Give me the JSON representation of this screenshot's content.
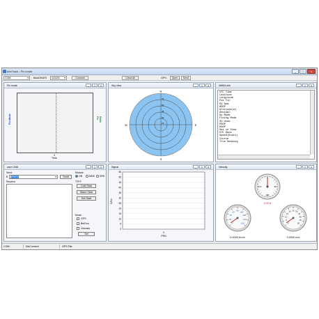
{
  "app": {
    "title": "mtxTrack - Fix mode",
    "controls": {
      "minimize": "_",
      "maximize": "□",
      "close": "x"
    }
  },
  "toolbar": {
    "port": "COM",
    "baudrate_label": "BAUDRATE",
    "baudrate_value": "115200",
    "connect_label": "Connect",
    "clear_all_label": "Clear All",
    "gps_label": "GPS:",
    "open_label": "Open",
    "send_label": "Send"
  },
  "fix_mode": {
    "title": "Fix mode",
    "left_axis": "Fix Mode",
    "right_axis": "Ratio Fix",
    "bottom_tick": "0",
    "bottom_axis": "Time"
  },
  "sky_view": {
    "title": "Sky view",
    "north": "N",
    "south": "S",
    "east": "E",
    "west": "W",
    "rings": [
      "75",
      "60",
      "45",
      "30",
      "15"
    ]
  },
  "nmea_info": {
    "title": "NMEA info",
    "lines": [
      "UTC Time",
      "Latitude",
      "Longitude",
      "Pos Fix",
      "SV Num",
      "HDOP",
      "Altitude(m)",
      "Geoidal",
      "Op Mode",
      "Fixing Mode",
      "SV Used",
      "PDOP",
      "VDOP",
      "Sat in View",
      "UTC Date",
      "Speed(Knots)",
      "Course",
      "True Heading"
    ]
  },
  "user_cmd": {
    "title": "user CMD",
    "send_group": "Send",
    "prefix": "$",
    "cmd_value": "$PMTK",
    "send_button": "Send",
    "receive_label": "Receive",
    "module_label": "Module",
    "module_options": [
      "GB",
      "MDE",
      "SRE"
    ],
    "ttff_label": "TTFF",
    "cold_start": "Cold Start",
    "warm_start": "Warm Start",
    "hot_start": "Hot Start",
    "mode_label": "Mode",
    "mode_options": [
      "GPS",
      "BeiDou",
      "Glonass"
    ],
    "set_button": "Set"
  },
  "signal": {
    "title": "Signal",
    "ylabel": "C/No",
    "xlabel": "PRN",
    "x_tick": "0",
    "y_ticks": [
      "55",
      "50",
      "45",
      "40",
      "35",
      "30",
      "25",
      "20",
      "15",
      "10",
      "5",
      "0"
    ]
  },
  "velocity": {
    "title": "Velocity",
    "compass_text": "0.00 N",
    "compass_ticks": [
      "0",
      "90",
      "180",
      "270"
    ],
    "kmh_ticks": [
      "0",
      "20",
      "40",
      "60",
      "80",
      "100",
      "120",
      "140",
      "160"
    ],
    "ms_ticks": [
      "0",
      "5",
      "10",
      "15",
      "20",
      "25",
      "30",
      "35",
      "40",
      "45",
      "50"
    ],
    "kmh_readout": "0.0000 Km/h",
    "ms_readout": "0.0000 m/s",
    "colors": {
      "needle": "#d02020",
      "scale_blue": "#1e5aa0"
    }
  },
  "status": {
    "com": "COM:",
    "connect": "DisConnect",
    "gps_file": "GPS File:"
  }
}
